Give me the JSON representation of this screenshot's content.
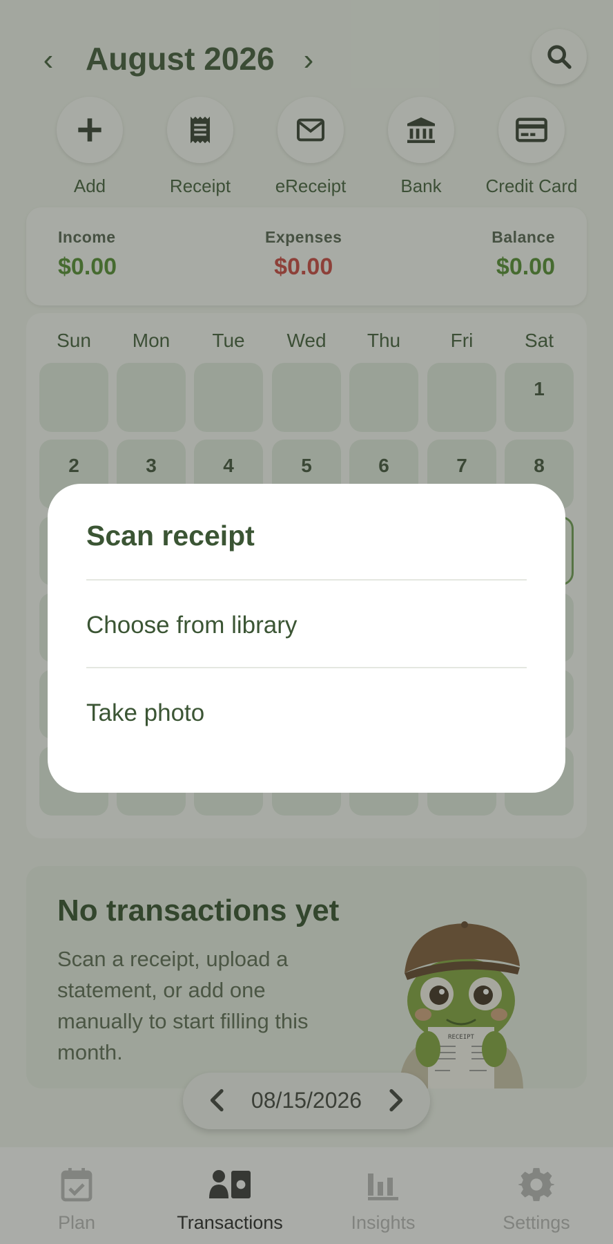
{
  "header": {
    "prev_label": "‹",
    "next_label": "›",
    "month_title": "August 2026"
  },
  "actions": [
    {
      "label": "Add",
      "icon": "plus-icon"
    },
    {
      "label": "Receipt",
      "icon": "receipt-icon"
    },
    {
      "label": "eReceipt",
      "icon": "envelope-icon"
    },
    {
      "label": "Bank",
      "icon": "bank-icon"
    },
    {
      "label": "Credit Card",
      "icon": "credit-card-icon"
    }
  ],
  "summary": {
    "income_label": "Income",
    "income_value": "$0.00",
    "expenses_label": "Expenses",
    "expenses_value": "$0.00",
    "balance_label": "Balance",
    "balance_value": "$0.00"
  },
  "calendar": {
    "weekdays": [
      "Sun",
      "Mon",
      "Tue",
      "Wed",
      "Thu",
      "Fri",
      "Sat"
    ],
    "week1": [
      "",
      "",
      "",
      "",
      "",
      "",
      "1"
    ],
    "week2": [
      "2",
      "3",
      "4",
      "5",
      "6",
      "7",
      "8"
    ]
  },
  "empty_state": {
    "title": "No transactions yet",
    "text": "Scan a receipt, upload a statement, or add one manually to start filling this month.",
    "receipt_text": "RECEIPT"
  },
  "date_pill": {
    "date": "08/15/2026"
  },
  "nav": [
    {
      "label": "Plan",
      "icon": "calendar-check-icon"
    },
    {
      "label": "Transactions",
      "icon": "transactions-icon",
      "active": true
    },
    {
      "label": "Insights",
      "icon": "bar-chart-icon"
    },
    {
      "label": "Settings",
      "icon": "gear-icon"
    }
  ],
  "dialog": {
    "title": "Scan receipt",
    "option_library": "Choose from library",
    "option_photo": "Take photo"
  },
  "colors": {
    "primary": "#3b5534",
    "income": "#4f8a2c",
    "expense": "#c9413b"
  }
}
